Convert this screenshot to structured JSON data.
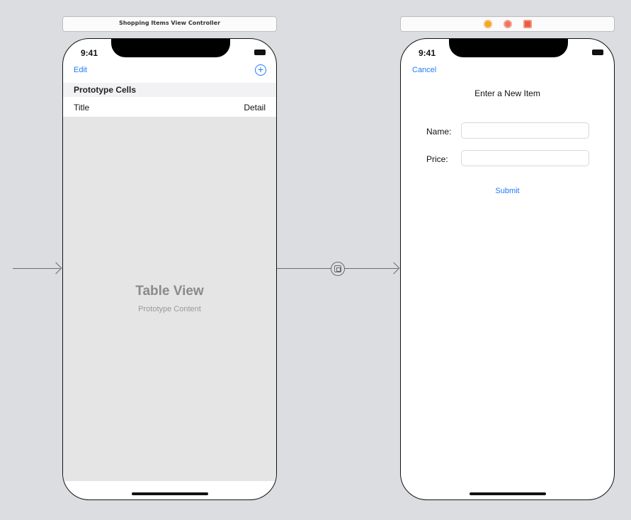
{
  "scenes": {
    "shopping": {
      "title": "Shopping Items View Controller",
      "status_time": "9:41",
      "nav": {
        "left": "Edit",
        "right_icon": "plus-circle-icon",
        "right_glyph": "+"
      },
      "section_header": "Prototype Cells",
      "cell": {
        "title": "Title",
        "detail": "Detail"
      },
      "table_placeholder": {
        "title": "Table View",
        "subtitle": "Prototype Content"
      }
    },
    "new_item": {
      "bar_icons": [
        "view-controller-icon",
        "first-responder-icon",
        "exit-icon"
      ],
      "status_time": "9:41",
      "nav": {
        "left": "Cancel"
      },
      "form_title": "Enter a New Item",
      "fields": [
        {
          "label": "Name:",
          "value": ""
        },
        {
          "label": "Price:",
          "value": ""
        }
      ],
      "submit": "Submit"
    }
  },
  "colors": {
    "canvas": "#dcdde0",
    "accent": "#1e7cf2",
    "table_bg": "#e5e5e5"
  }
}
